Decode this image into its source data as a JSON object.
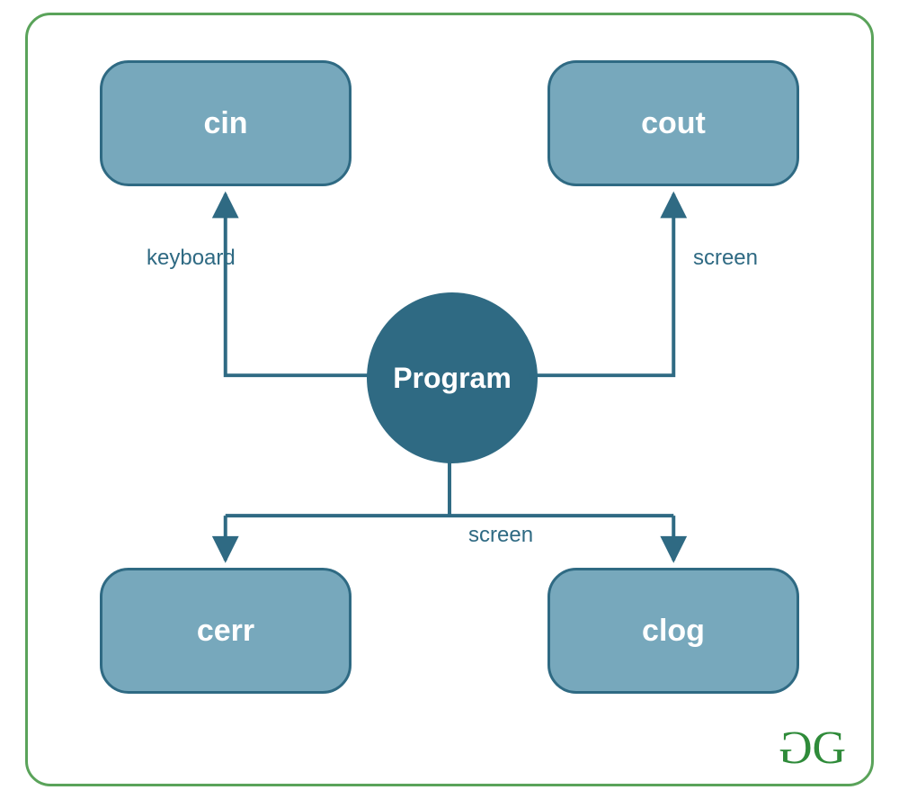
{
  "nodes": {
    "cin": {
      "label": "cin"
    },
    "cout": {
      "label": "cout"
    },
    "cerr": {
      "label": "cerr"
    },
    "clog": {
      "label": "clog"
    },
    "program": {
      "label": "Program"
    }
  },
  "edges": {
    "cin_to_program": {
      "label": "keyboard"
    },
    "program_to_cout": {
      "label": "screen"
    },
    "program_to_cerr_clog": {
      "label": "screen"
    }
  },
  "colors": {
    "frame_border": "#5aa35a",
    "node_fill": "#77a8bc",
    "node_border": "#2f6a83",
    "program_fill": "#2f6a83",
    "text_on_node": "#ffffff",
    "edge_stroke": "#2f6a83",
    "edge_label": "#2f6a83",
    "logo": "#2f8b3a"
  },
  "logo": {
    "text": "GG",
    "brand": "GeeksforGeeks"
  },
  "diagram": {
    "description": "C++ standard I/O streams: Program reads from cin (keyboard), writes to cout (screen), and writes errors/log to cerr and clog (screen)."
  }
}
